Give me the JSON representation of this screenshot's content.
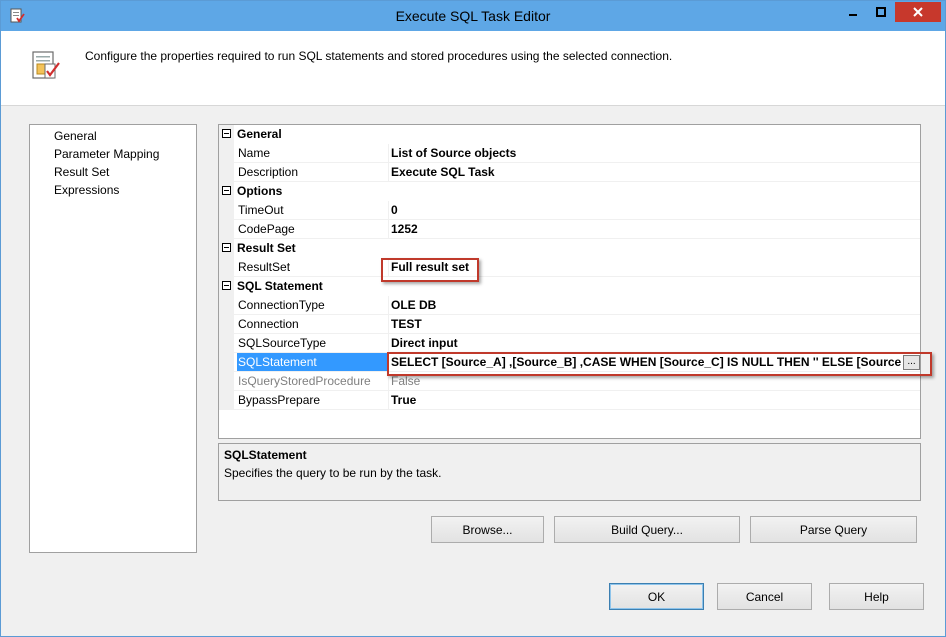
{
  "window": {
    "title": "Execute SQL Task Editor",
    "title_icon": "task-editor-icon"
  },
  "header": {
    "icon": "sql-task-icon",
    "description": "Configure the properties required to run SQL statements and stored procedures using the selected connection."
  },
  "nav": {
    "items": [
      {
        "label": "General",
        "selected": true
      },
      {
        "label": "Parameter Mapping",
        "selected": false
      },
      {
        "label": "Result Set",
        "selected": false
      },
      {
        "label": "Expressions",
        "selected": false
      }
    ]
  },
  "grid": {
    "categories": {
      "general": "General",
      "options": "Options",
      "result_set": "Result Set",
      "sql_statement": "SQL Statement"
    },
    "general": {
      "name_label": "Name",
      "name_value": "List of Source objects",
      "description_label": "Description",
      "description_value": "Execute SQL Task"
    },
    "options": {
      "timeout_label": "TimeOut",
      "timeout_value": "0",
      "codepage_label": "CodePage",
      "codepage_value": "1252"
    },
    "result_set": {
      "resultset_label": "ResultSet",
      "resultset_value": "Full result set"
    },
    "sql": {
      "connection_type_label": "ConnectionType",
      "connection_type_value": "OLE DB",
      "connection_label": "Connection",
      "connection_value": "TEST",
      "source_type_label": "SQLSourceType",
      "source_type_value": "Direct input",
      "statement_label": "SQLStatement",
      "statement_value": "SELECT [Source_A]       ,[Source_B]       ,CASE WHEN [Source_C] IS NULL THEN '' ELSE [Source_C",
      "statement_button": "...",
      "is_query_sp_label": "IsQueryStoredProcedure",
      "is_query_sp_value": "False",
      "bypass_label": "BypassPrepare",
      "bypass_value": "True"
    }
  },
  "description_panel": {
    "title": "SQLStatement",
    "text": "Specifies the query to be run by the task."
  },
  "buttons": {
    "browse": "Browse...",
    "build_query": "Build Query...",
    "parse_query": "Parse Query",
    "ok": "OK",
    "cancel": "Cancel",
    "help": "Help"
  },
  "colors": {
    "titlebar": "#5ea7e6",
    "close_button": "#c7382c",
    "selection": "#3399ff",
    "highlight_box": "#c0392b"
  }
}
